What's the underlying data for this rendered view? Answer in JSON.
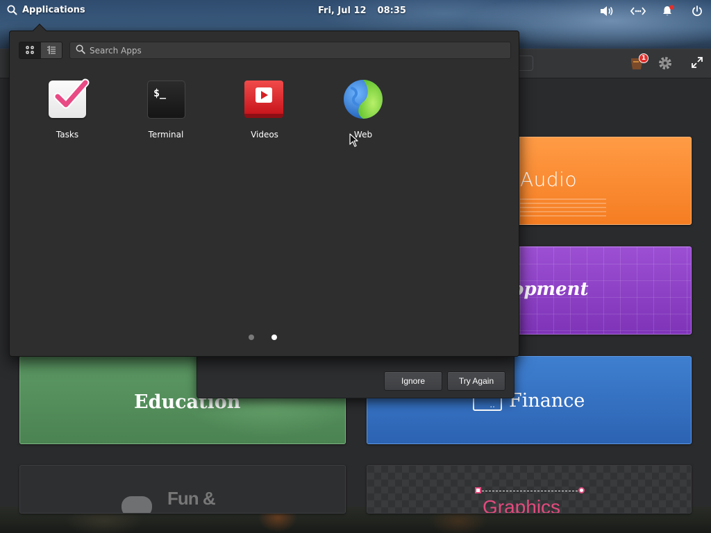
{
  "panel": {
    "applications_label": "Applications",
    "date": "Fri, Jul 12",
    "time": "08:35",
    "indicators": [
      "volume-icon",
      "network-icon",
      "notifications-icon",
      "power-icon"
    ]
  },
  "launcher": {
    "search_placeholder": "Search Apps",
    "view_modes": [
      "grid-view-icon",
      "category-view-icon"
    ],
    "apps": [
      {
        "label": "Tasks",
        "icon": "tasks-icon"
      },
      {
        "label": "Terminal",
        "icon": "terminal-icon",
        "glyph": "$_"
      },
      {
        "label": "Videos",
        "icon": "videos-icon"
      },
      {
        "label": "Web",
        "icon": "web-icon"
      }
    ],
    "pages": 2,
    "current_page": 2
  },
  "background_window": {
    "update_badge": "1",
    "categories": {
      "audio": "Audio",
      "development": "opment",
      "education": "Education",
      "finance": "Finance",
      "fun": "Fun &",
      "graphics": "Graphics"
    },
    "finance_icon_glyph": ".."
  },
  "dialog": {
    "ignore_label": "Ignore",
    "retry_label": "Try Again"
  },
  "colors": {
    "accent_orange": "#f57d22",
    "accent_purple": "#8b3fc4",
    "accent_green": "#4f8a56",
    "accent_blue": "#3571c2",
    "badge_red": "#e0312e"
  }
}
